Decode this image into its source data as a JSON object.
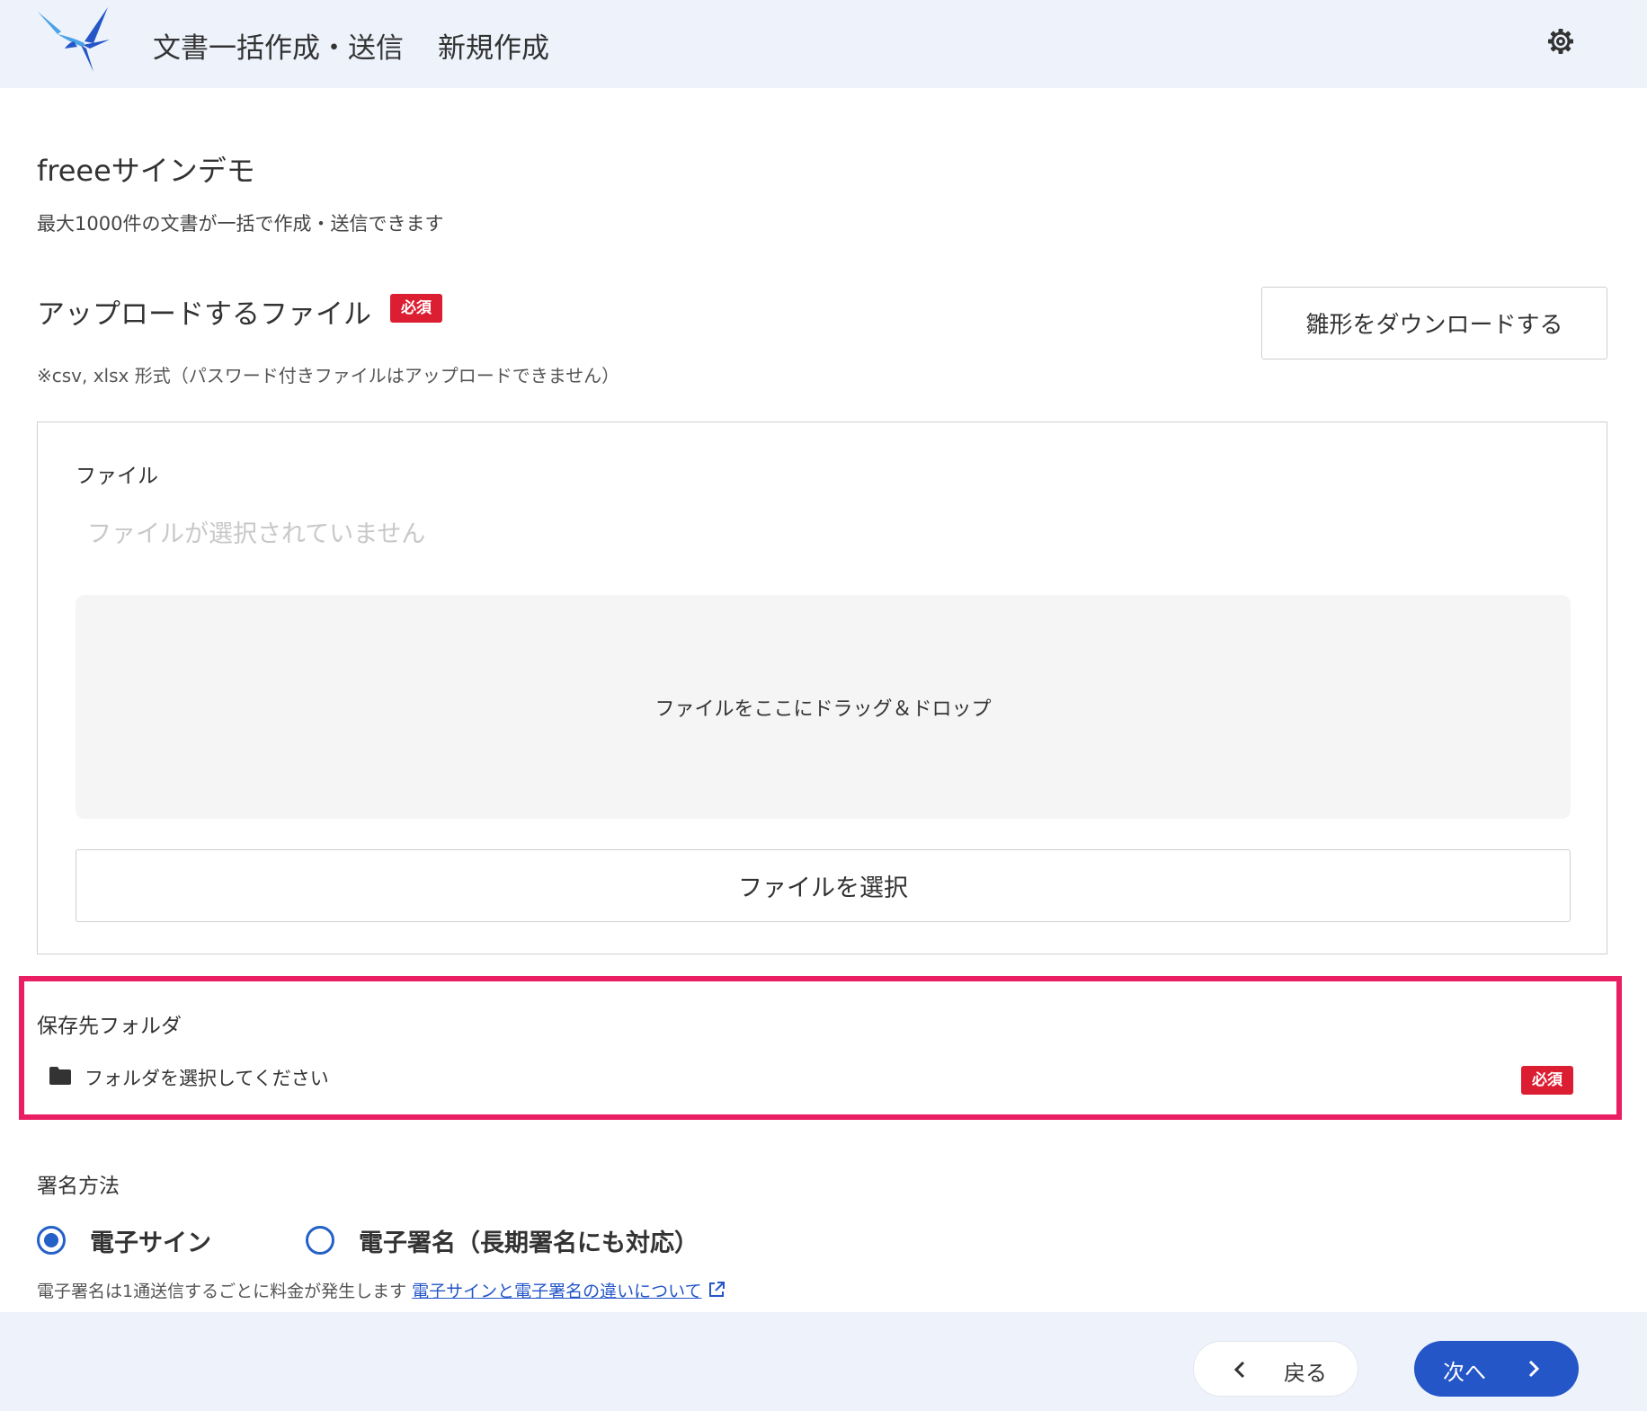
{
  "header": {
    "app_title": "文書一括作成・送信",
    "page_subtitle": "新規作成",
    "settings_icon": "gear-icon"
  },
  "main": {
    "org_name": "freeeサインデモ",
    "intro": "最大1000件の文書が一括で作成・送信できます",
    "upload": {
      "heading": "アップロードするファイル",
      "required_badge": "必須",
      "format_note": "※csv, xlsx 形式（パスワード付きファイルはアップロードできません）",
      "template_download_label": "雛形をダウンロードする",
      "file_label": "ファイル",
      "no_file_placeholder": "ファイルが選択されていません",
      "dropzone_text": "ファイルをここにドラッグ＆ドロップ",
      "select_file_label": "ファイルを選択"
    },
    "folder": {
      "label": "保存先フォルダ",
      "placeholder": "フォルダを選択してください",
      "required_badge": "必須"
    },
    "signature": {
      "label": "署名方法",
      "options": [
        {
          "label": "電子サイン",
          "selected": true
        },
        {
          "label": "電子署名（長期署名にも対応）",
          "selected": false
        }
      ],
      "note": "電子署名は1通送信するごとに料金が発生します ",
      "link_text": "電子サインと電子署名の違いについて"
    }
  },
  "footer": {
    "back_label": "戻る",
    "next_label": "次へ"
  },
  "colors": {
    "accent": "#2456c8",
    "required_badge": "#dc1e32",
    "highlight": "#ea1e63",
    "header_bg": "#edf2fb"
  }
}
